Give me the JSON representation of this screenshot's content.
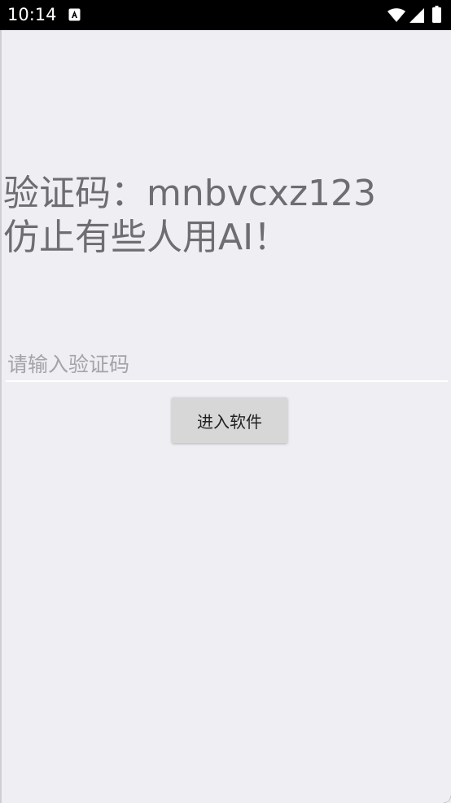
{
  "status_bar": {
    "time": "10:14",
    "icons": [
      "notification-a-icon",
      "wifi-icon",
      "signal-icon",
      "battery-icon"
    ]
  },
  "verification": {
    "code_line": "验证码：mnbvcxz123",
    "warning_line": "仿止有些人用AI！"
  },
  "code_input": {
    "placeholder": "请输入验证码",
    "value": ""
  },
  "enter_button": {
    "label": "进入软件"
  },
  "colors": {
    "background": "#efeef3",
    "title_text": "#6d6d72",
    "button_bg": "#d7d7d8",
    "status_bar": "#000000"
  }
}
